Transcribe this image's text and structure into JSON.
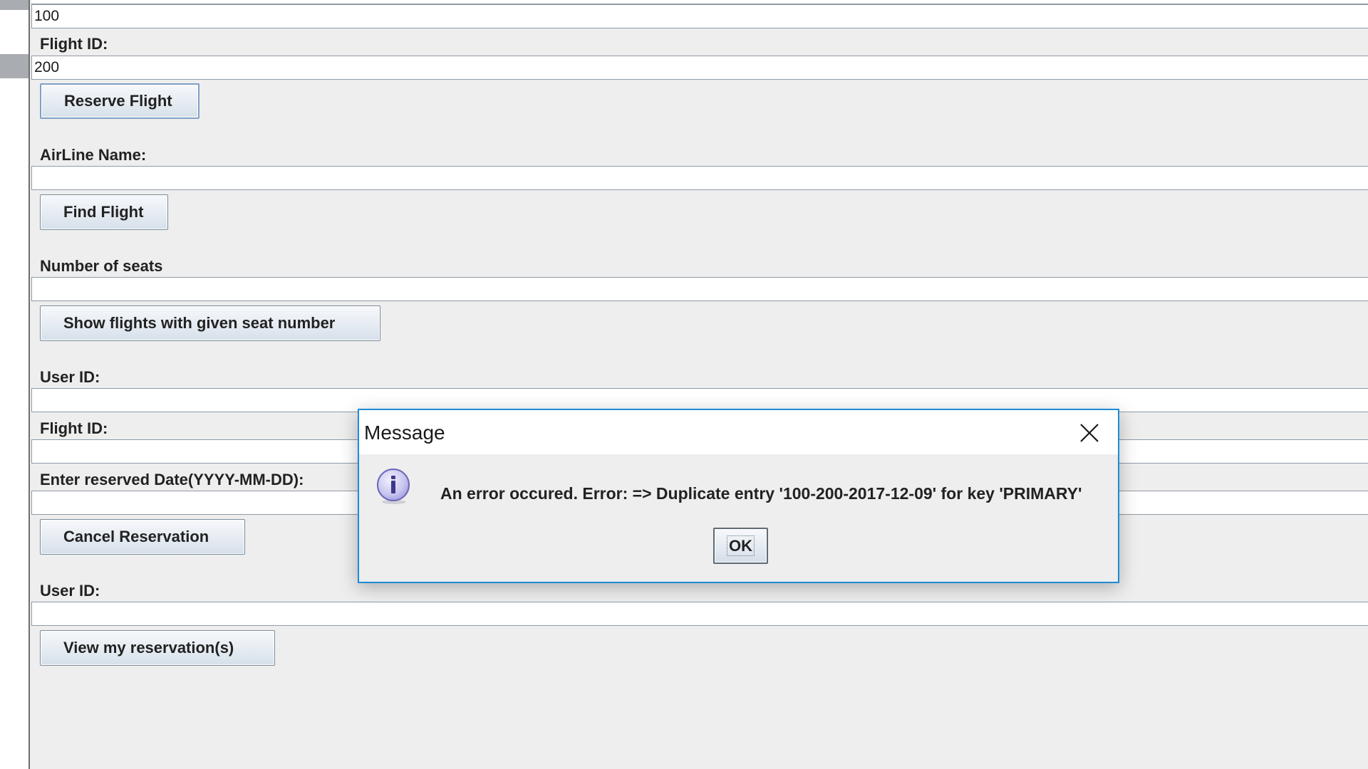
{
  "form": {
    "user_id_value_1": "100",
    "flight_id_label_1": "Flight ID:",
    "flight_id_value_1": "200",
    "reserve_button": "Reserve Flight",
    "airline_label": "AirLine Name:",
    "airline_value": "",
    "find_flight_button": "Find Flight",
    "seats_label": "Number of seats",
    "seats_value": "",
    "show_flights_button": "Show flights with given seat number",
    "user_id_label_2": "User ID:",
    "user_id_value_2": "",
    "flight_id_label_2": "Flight ID:",
    "flight_id_value_2": "",
    "date_label": "Enter reserved Date(YYYY-MM-DD):",
    "date_value": "",
    "cancel_button": "Cancel Reservation",
    "user_id_label_3": "User ID:",
    "user_id_value_3": "",
    "view_reservations_button": "View my reservation(s)"
  },
  "dialog": {
    "title": "Message",
    "message": "An error occured. Error: => Duplicate entry '100-200-2017-12-09' for key 'PRIMARY'",
    "ok_label": "OK",
    "icon": "info-icon",
    "close_icon": "close-icon"
  },
  "colors": {
    "panel_background": "#eeeeee",
    "dialog_border": "#1f8bd6",
    "info_icon_fill": "#c9c6f0"
  }
}
